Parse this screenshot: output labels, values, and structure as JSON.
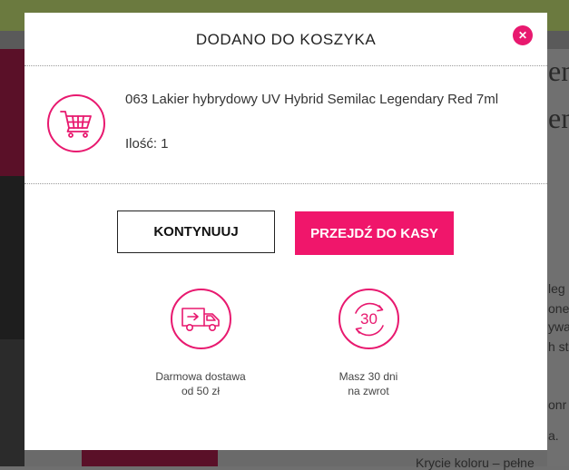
{
  "background": {
    "right_text_1": "en",
    "right_text_2": "en",
    "right_frag_1": "leg",
    "right_frag_2": "one",
    "right_frag_3": "ywa",
    "right_frag_4": "h st",
    "right_frag_5": "onr",
    "right_frag_6": "a.",
    "bottom_text": "Krycie koloru – pełne"
  },
  "modal": {
    "title": "DODANO DO KOSZYKA",
    "close_symbol": "✕",
    "product": {
      "icon": "shopping-cart-icon",
      "name": "063 Lakier hybrydowy UV Hybrid Semilac Legendary Red 7ml",
      "quantity": "Ilość: 1"
    },
    "buttons": {
      "continue": "KONTYNUUJ",
      "checkout": "PRZEJDŹ DO KASY"
    },
    "features": [
      {
        "icon": "delivery-truck-icon",
        "line1": "Darmowa dostawa",
        "line2": "od 50 zł"
      },
      {
        "icon": "return-30-icon",
        "badge": "30",
        "line1": "Masz 30 dni",
        "line2": "na zwrot"
      }
    ],
    "colors": {
      "accent": "#e8196f",
      "checkout_bg": "#f0166b"
    }
  }
}
